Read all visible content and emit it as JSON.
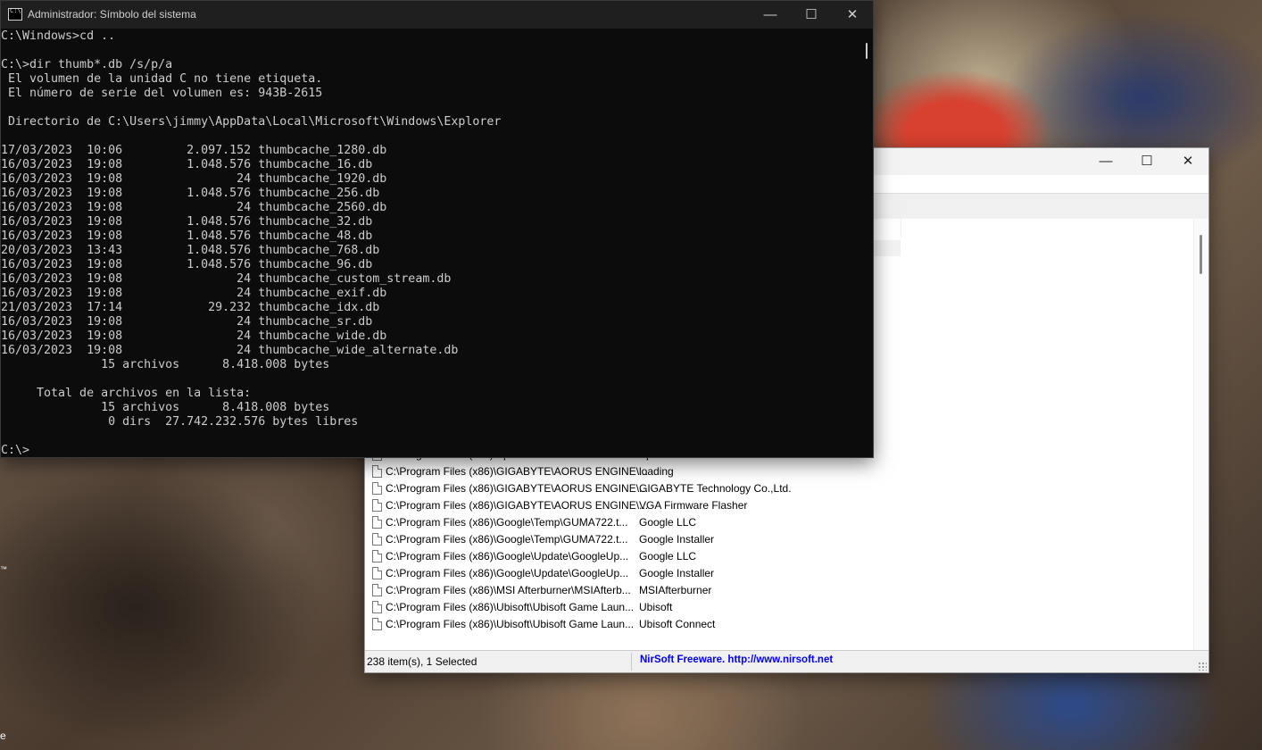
{
  "desktop": {
    "tm_mark": "™",
    "edge_letter": "e"
  },
  "cmd": {
    "title": "Administrador: Símbolo del sistema",
    "controls": {
      "minimize": "—",
      "maximize": "☐",
      "close": "✕"
    },
    "icon_text": "C:\\",
    "lines": [
      "C:\\Windows>cd ..",
      "",
      "C:\\>dir thumb*.db /s/p/a",
      " El volumen de la unidad C no tiene etiqueta.",
      " El número de serie del volumen es: 943B-2615",
      "",
      " Directorio de C:\\Users\\jimmy\\AppData\\Local\\Microsoft\\Windows\\Explorer",
      "",
      "17/03/2023  10:06         2.097.152 thumbcache_1280.db",
      "16/03/2023  19:08         1.048.576 thumbcache_16.db",
      "16/03/2023  19:08                24 thumbcache_1920.db",
      "16/03/2023  19:08         1.048.576 thumbcache_256.db",
      "16/03/2023  19:08                24 thumbcache_2560.db",
      "16/03/2023  19:08         1.048.576 thumbcache_32.db",
      "16/03/2023  19:08         1.048.576 thumbcache_48.db",
      "20/03/2023  13:43         1.048.576 thumbcache_768.db",
      "16/03/2023  19:08         1.048.576 thumbcache_96.db",
      "16/03/2023  19:08                24 thumbcache_custom_stream.db",
      "16/03/2023  19:08                24 thumbcache_exif.db",
      "21/03/2023  17:14            29.232 thumbcache_idx.db",
      "16/03/2023  19:08                24 thumbcache_sr.db",
      "16/03/2023  19:08                24 thumbcache_wide.db",
      "16/03/2023  19:08                24 thumbcache_wide_alternate.db",
      "              15 archivos      8.418.008 bytes",
      "",
      "     Total de archivos en la lista:",
      "              15 archivos      8.418.008 bytes",
      "               0 dirs  27.742.232.576 bytes libres",
      "",
      "C:\\>"
    ]
  },
  "nirsoft": {
    "controls": {
      "minimize": "—",
      "maximize": "☐",
      "close": "✕"
    },
    "rows": [
      {
        "path": "C:\\Program Files (x86)\\Epic Games\\Launcher\\Port...",
        "name": "EpicGamesLauncher"
      },
      {
        "path": "C:\\Program Files (x86)\\GIGABYTE\\AORUS ENGINE\\...",
        "name": "loading"
      },
      {
        "path": "C:\\Program Files (x86)\\GIGABYTE\\AORUS ENGINE\\...",
        "name": "GIGABYTE Technology Co.,Ltd."
      },
      {
        "path": "C:\\Program Files (x86)\\GIGABYTE\\AORUS ENGINE\\...",
        "name": "VGA Firmware Flasher"
      },
      {
        "path": "C:\\Program Files (x86)\\Google\\Temp\\GUMA722.t...",
        "name": "Google LLC"
      },
      {
        "path": "C:\\Program Files (x86)\\Google\\Temp\\GUMA722.t...",
        "name": "Google Installer"
      },
      {
        "path": "C:\\Program Files (x86)\\Google\\Update\\GoogleUp...",
        "name": "Google LLC"
      },
      {
        "path": "C:\\Program Files (x86)\\Google\\Update\\GoogleUp...",
        "name": "Google Installer"
      },
      {
        "path": "C:\\Program Files (x86)\\MSI Afterburner\\MSIAfterb...",
        "name": "MSIAfterburner"
      },
      {
        "path": "C:\\Program Files (x86)\\Ubisoft\\Ubisoft Game Laun...",
        "name": "Ubisoft"
      },
      {
        "path": "C:\\Program Files (x86)\\Ubisoft\\Ubisoft Game Laun...",
        "name": "Ubisoft Connect"
      }
    ],
    "status": {
      "items": "238 item(s), 1 Selected",
      "credit": "NirSoft Freeware.  http://www.nirsoft.net"
    }
  }
}
